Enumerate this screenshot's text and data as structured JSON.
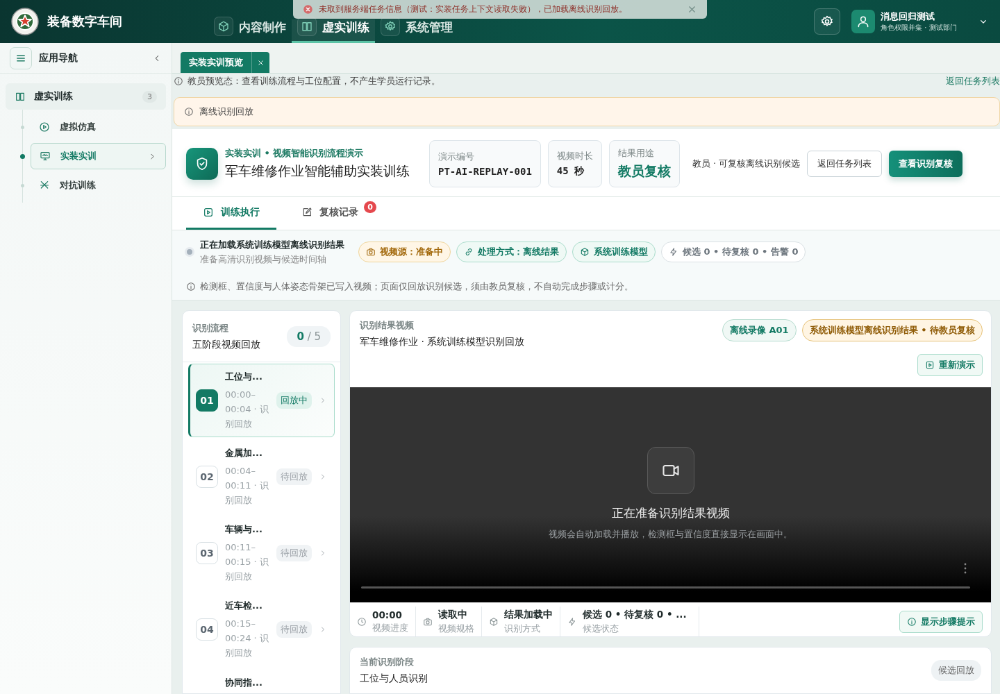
{
  "header": {
    "title": "装备数字车间",
    "nav": [
      {
        "label": "内容制作",
        "selected": false
      },
      {
        "label": "虚实训练",
        "selected": true
      },
      {
        "label": "系统管理",
        "selected": false
      }
    ],
    "user": {
      "name": "消息回归测试",
      "role": "角色权限并集 · 测试部门"
    }
  },
  "toast": {
    "message": "未取到服务端任务信息（测试：实装任务上下文读取失败），已加载离线识别回放。"
  },
  "sidebar": {
    "title": "应用导航",
    "groups": [
      {
        "label": "虚实训练",
        "count": "3",
        "expanded": true,
        "children": [
          {
            "label": "虚拟仿真",
            "selected": false
          },
          {
            "label": "实装实训",
            "selected": true
          },
          {
            "label": "对抗训练",
            "selected": false
          }
        ]
      }
    ]
  },
  "page_tabs": [
    {
      "label": "实装实训预览",
      "selected": true
    }
  ],
  "notice": {
    "text": "教员预览态：查看训练流程与工位配置，不产生学员运行记录。",
    "link": "返回任务列表"
  },
  "alert": {
    "text": "离线识别回放"
  },
  "task": {
    "category": "实装实训 • 视频智能识别流程演示",
    "title": "军车维修作业智能辅助实装训练",
    "stats": [
      {
        "label": "演示编号",
        "value": "PT-AI-REPLAY-001",
        "kind": "code"
      },
      {
        "label": "视频时长",
        "value": "45 秒",
        "kind": "code"
      },
      {
        "label": "结果用途",
        "value": "教员复核",
        "kind": "highlight"
      }
    ],
    "role_note": "教员 · 可复核离线识别候选",
    "buttons": [
      {
        "label": "返回任务列表",
        "kind": "secondary"
      },
      {
        "label": "查看识别复核",
        "kind": "primary"
      }
    ]
  },
  "sub_tabs": [
    {
      "label": "训练执行",
      "selected": true
    },
    {
      "label": "复核记录",
      "selected": false,
      "badge": "0"
    }
  ],
  "status": {
    "title": "正在加载系统训练模型离线识别结果",
    "subtitle": "准备高清识别视频与候选时间轴",
    "chips": [
      {
        "label": "视频源：准备中",
        "kind": "warning"
      },
      {
        "label": "处理方式：离线结果",
        "kind": "success"
      },
      {
        "label": "系统训练模型",
        "kind": "success"
      },
      {
        "label": "候选 0 • 待复核 0 • 告警 0",
        "kind": "neutral"
      }
    ]
  },
  "hint": "检测框、置信度与人体姿态骨架已写入视频；页面仅回放识别候选，须由教员复核，不自动完成步骤或计分。",
  "flow": {
    "label": "识别流程",
    "title": "五阶段视频回放",
    "done": "0",
    "total": "/ 5",
    "steps": [
      {
        "number": "01",
        "title": "工位与...",
        "time": "00:00–00:04 · 识别回放",
        "state": "回放中",
        "selected": true
      },
      {
        "number": "02",
        "title": "金属加...",
        "time": "00:04–00:11 · 识别回放",
        "state": "待回放",
        "selected": false
      },
      {
        "number": "03",
        "title": "车辆与...",
        "time": "00:11–00:15 · 识别回放",
        "state": "待回放",
        "selected": false
      },
      {
        "number": "04",
        "title": "近车检...",
        "time": "00:15–00:24 · 识别回放",
        "state": "待回放",
        "selected": false
      },
      {
        "title": "协同指...",
        "selected": false
      }
    ]
  },
  "video": {
    "label": "识别结果视频",
    "title": "军车维修作业 · 系统训练模型识别回放",
    "tags": [
      {
        "label": "离线录像 A01",
        "kind": "success"
      },
      {
        "label": "系统训练模型离线识别结果 • 待教员复核",
        "kind": "warning"
      }
    ],
    "replay": "重新演示",
    "placeholder_title": "正在准备识别结果视频",
    "placeholder_text": "视频会自动加载并播放，检测框与置信度直接显示在画面中。",
    "info": [
      {
        "value": "00:00",
        "label": "视频进度"
      },
      {
        "value": "读取中",
        "label": "视频规格"
      },
      {
        "value": "结果加载中",
        "label": "识别方式"
      },
      {
        "value": "候选 0 • 待复核 0 • ...",
        "label": "候选状态"
      }
    ],
    "hints_button": "显示步骤提示"
  },
  "stage": {
    "label": "当前识别阶段",
    "title": "工位与人员识别",
    "badge": "候选回放"
  }
}
